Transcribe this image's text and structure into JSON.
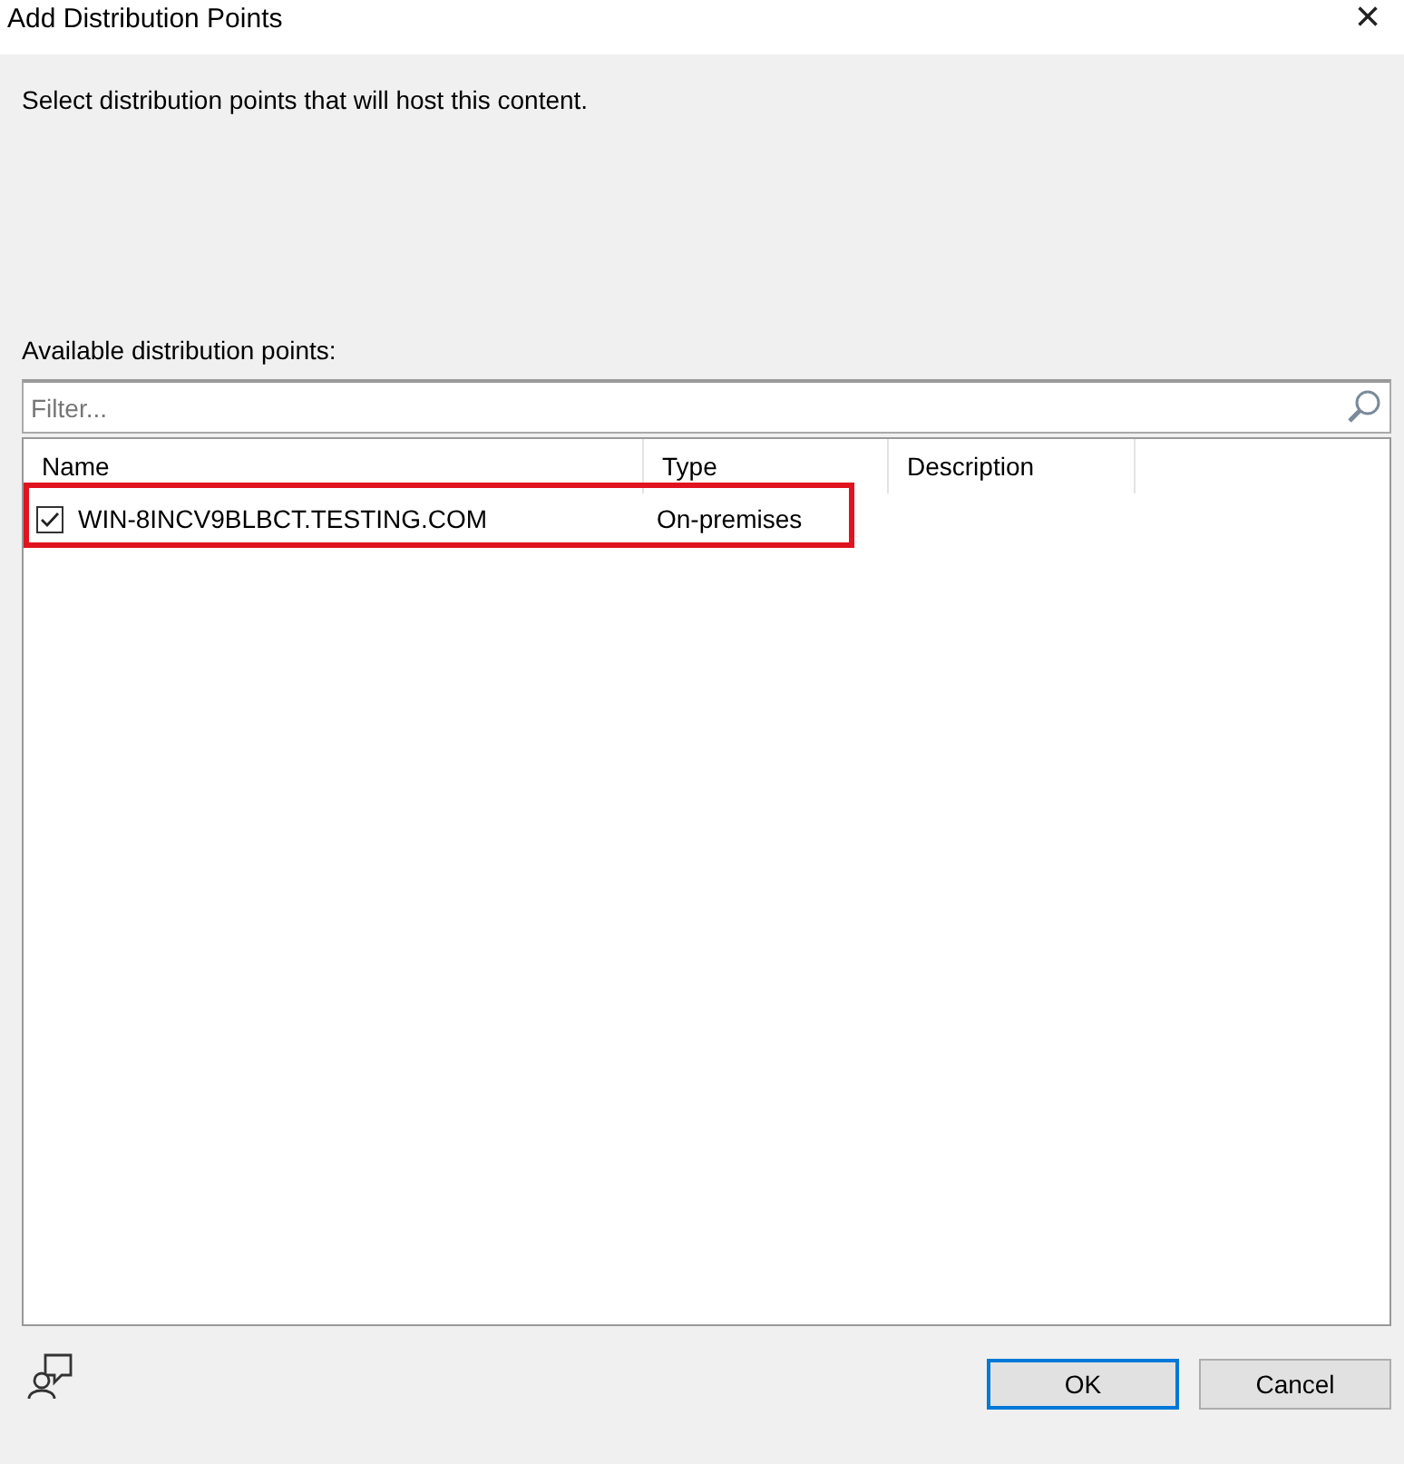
{
  "window": {
    "title": "Add Distribution Points",
    "close": "×"
  },
  "instruction": "Select distribution points that will host this content.",
  "list_label": "Available distribution points:",
  "filter": {
    "placeholder": "Filter..."
  },
  "table": {
    "columns": [
      "Name",
      "Type",
      "Description"
    ],
    "rows": [
      {
        "name": "WIN-8INCV9BLBCT.TESTING.COM",
        "type": "On-premises",
        "checked": true,
        "highlighted": true
      }
    ]
  },
  "buttons": [
    {
      "label": "OK",
      "default": true
    },
    {
      "label": "Cancel",
      "default": false
    }
  ]
}
